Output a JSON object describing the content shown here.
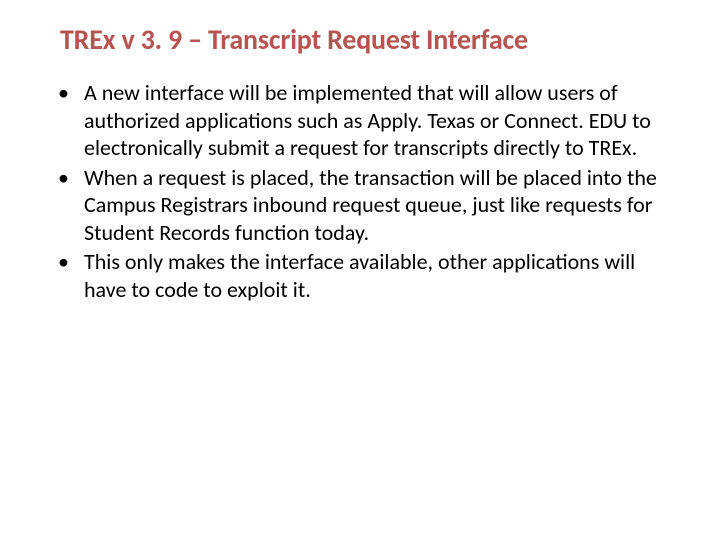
{
  "title": "TREx v 3. 9 – Transcript Request Interface",
  "bullets": [
    " A new interface will be implemented that will allow users of authorized applications such as Apply. Texas or Connect. EDU to electronically submit a request for transcripts directly to TREx.",
    " When a request is placed, the transaction will be placed into the Campus Registrars inbound request queue, just like requests for Student Records function today.",
    "This only makes the interface available,  other applications will have to code to exploit it."
  ]
}
